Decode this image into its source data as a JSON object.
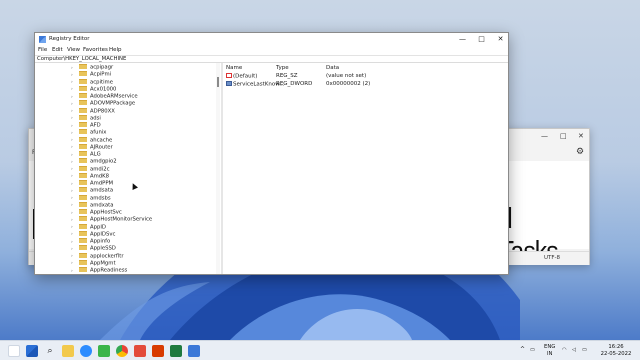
{
  "background_window": {
    "menu_label": "Fi",
    "document_text": "d Tasks",
    "status_encoding": "UTF-8"
  },
  "registry_editor": {
    "title": "Registry Editor",
    "menu": [
      "File",
      "Edit",
      "View",
      "Favorites",
      "Help"
    ],
    "address": "Computer\\HKEY_LOCAL_MACHINE",
    "tree_items": [
      "acpipagr",
      "AcpiPmi",
      "acpitime",
      "Acx01000",
      "AdobeARMservice",
      "ADOVMPPackage",
      "ADP80XX",
      "adsi",
      "AFD",
      "afunix",
      "ahcache",
      "AJRouter",
      "ALG",
      "amdgpio2",
      "amdi2c",
      "AmdK8",
      "AmdPPM",
      "amdsata",
      "amdsbs",
      "amdxata",
      "AppHostSvc",
      "AppHostMonitorService",
      "AppID",
      "AppIDSvc",
      "Appinfo",
      "AppleSSD",
      "applockerfltr",
      "AppMgmt",
      "AppReadiness"
    ],
    "columns": [
      "Name",
      "Type",
      "Data"
    ],
    "values": [
      {
        "name": "(Default)",
        "type": "REG_SZ",
        "data": "(value not set)",
        "icon": "string-value-icon"
      },
      {
        "name": "ServiceLastKnow...",
        "type": "REG_DWORD",
        "data": "0x00000002 (2)",
        "icon": "binary-value-icon"
      }
    ]
  },
  "taskbar": {
    "language_top": "ENG",
    "language_bottom": "IN",
    "time": "16:26",
    "date": "22-05-2022"
  }
}
